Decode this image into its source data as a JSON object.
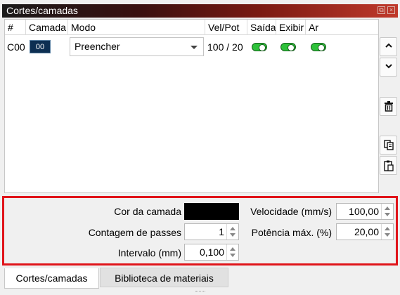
{
  "panel": {
    "title": "Cortes/camadas"
  },
  "table": {
    "headers": [
      "#",
      "Camada",
      "Modo",
      "Vel/Pot",
      "Saída",
      "Exibir",
      "Ar"
    ],
    "rows": [
      {
        "id": "C00",
        "layer": "00",
        "mode": "Preencher",
        "speed_power": "100 / 20",
        "output": true,
        "show": true,
        "air": true
      }
    ]
  },
  "side_buttons": [
    "move-up",
    "move-down",
    "delete",
    "copy",
    "paste"
  ],
  "properties": {
    "layer_color_label": "Cor da camada",
    "layer_color": "#000000",
    "passes_label": "Contagem de passes",
    "passes_value": "1",
    "interval_label": "Intervalo (mm)",
    "interval_value": "0,100",
    "speed_label": "Velocidade (mm/s)",
    "speed_value": "100,00",
    "power_label": "Potência máx. (%)",
    "power_value": "20,00"
  },
  "tabs": [
    {
      "label": "Cortes/camadas",
      "active": true
    },
    {
      "label": "Biblioteca de materiais",
      "active": false
    }
  ],
  "colors": {
    "highlight_border": "#e0141a",
    "toggle_on": "#2ec23a",
    "layer_swatch": "#0d2f52"
  }
}
